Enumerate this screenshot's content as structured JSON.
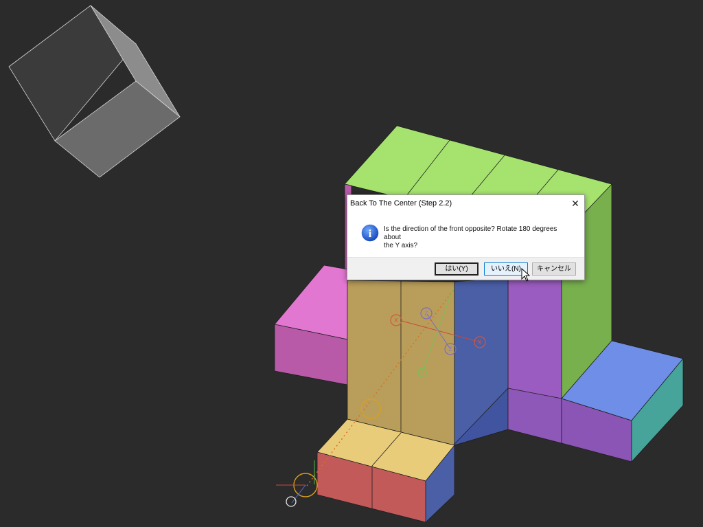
{
  "dialog": {
    "title": "Back To The Center (Step 2.2)",
    "message_line1": "Is the direction of the front opposite? Rotate 180 degrees about",
    "message_line2": "the Y axis?",
    "buttons": {
      "yes": "はい(Y)",
      "no": "いいえ(N)",
      "cancel": "キャンセル"
    },
    "close_glyph": "✕",
    "info_icon": "info-icon",
    "info_glyph": "i"
  },
  "gizmo": {
    "x_label": "X",
    "z_label": "Z"
  },
  "colors": {
    "background": "#2b2b2b",
    "green_top": "#a6e36e",
    "magenta": "#e277d2",
    "tan": "#b99d5a",
    "blue": "#4a5fa6",
    "purple": "#9a5cc0",
    "light_blue": "#6f8ee8",
    "teal": "#46a49a",
    "red": "#c25a5a",
    "yellow": "#e8cc79"
  }
}
